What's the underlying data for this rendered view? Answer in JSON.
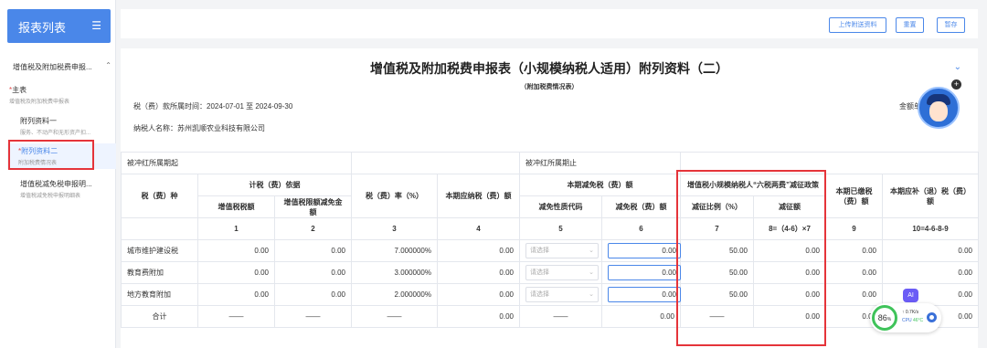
{
  "sidebar": {
    "header": "报表列表",
    "group_title": "增值税及附加税费申报...",
    "items": [
      {
        "star": "*",
        "title": "主表",
        "sub": "增值税及附加税费申报表"
      },
      {
        "star": "",
        "title": "附列资料一",
        "sub": "服务、不动产和无形资产扣..."
      },
      {
        "star": "*",
        "title": "附列资料二",
        "sub": "附加税费情况表"
      },
      {
        "star": "",
        "title": "增值税减免税申报明...",
        "sub": "增值税减免税申报明细表"
      }
    ]
  },
  "toolbar": {
    "upload_label": "上传附送资料",
    "reset_label": "重置",
    "save_label": "暂存"
  },
  "form": {
    "title": "增值税及附加税费申报表（小规模纳税人适用）附列资料（二）",
    "subtitle": "（附加税费情况表）",
    "period": "税（费）款所属时间：2024-07-01 至 2024-09-30",
    "taxpayer": "纳税人名称：苏州凯顺农业科技有限公司",
    "unit": "金额单位：元",
    "mascot_badge": "+"
  },
  "table": {
    "offset_start": "被冲红所属期起",
    "offset_end": "被冲红所属期止",
    "h_tax_type": "税（费）种",
    "h_basis": "计税（费）依据",
    "h_vat": "增值税税额",
    "h_vat_deduct": "增值税限额减免金额",
    "h_rate": "税（费）率（%）",
    "h_payable": "本期应纳税（费）额",
    "h_relief": "本期减免税（费）额",
    "h_relief_code": "减免性质代码",
    "h_relief_amount": "减免税（费）额",
    "h_six_tax": "增值税小规模纳税人“六税两费”减征政策",
    "h_reduce_ratio": "减征比例（%）",
    "h_reduce_amount": "减征额",
    "h_paid": "本期已缴税（费）额",
    "h_due": "本期应补（退）税（费）额",
    "col_numbers": [
      "1",
      "2",
      "3",
      "4",
      "5",
      "6",
      "7",
      "8=（4-6）×7",
      "9",
      "10=4-6-8-9"
    ],
    "select_placeholder": "请选择",
    "rows": [
      {
        "name": "城市维护建设税",
        "vat": "0.00",
        "deduct": "0.00",
        "rate": "7.000000%",
        "payable": "0.00",
        "relief": "0.00",
        "ratio": "50.00",
        "reduce": "0.00",
        "paid": "0.00",
        "due": "0.00"
      },
      {
        "name": "教育费附加",
        "vat": "0.00",
        "deduct": "0.00",
        "rate": "3.000000%",
        "payable": "0.00",
        "relief": "0.00",
        "ratio": "50.00",
        "reduce": "0.00",
        "paid": "0.00",
        "due": "0.00"
      },
      {
        "name": "地方教育附加",
        "vat": "0.00",
        "deduct": "0.00",
        "rate": "2.000000%",
        "payable": "0.00",
        "relief": "0.00",
        "ratio": "50.00",
        "reduce": "0.00",
        "paid": "0.00",
        "due": "0.00"
      }
    ],
    "total": {
      "name": "合计",
      "dash": "——",
      "payable": "0.00",
      "relief": "0.00",
      "reduce": "0.00",
      "paid": "0.00",
      "due": "0.00"
    }
  },
  "widgets": {
    "ai": "AI",
    "perf_value": "86",
    "perf_unit": "%",
    "net_speed": "0.7K/s",
    "cpu_label": "CPU",
    "cpu_temp": "46°C"
  },
  "colors": {
    "accent": "#4a87e9",
    "highlight": "#e5343a"
  }
}
